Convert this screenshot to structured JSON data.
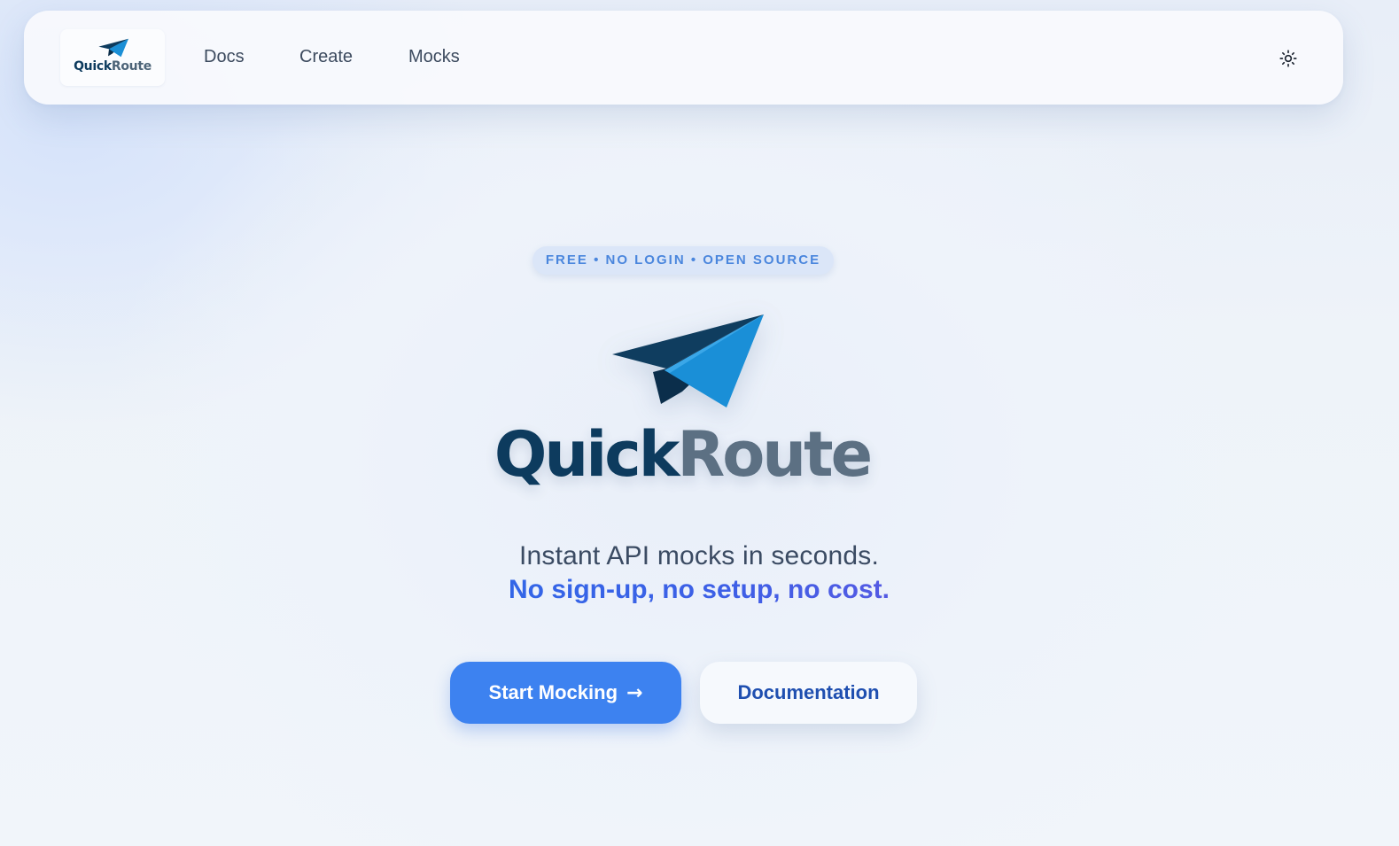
{
  "nav": {
    "logo": {
      "word_part1": "Quick",
      "word_part2": "Route",
      "icon": "paper-plane-icon"
    },
    "links": [
      {
        "label": "Docs"
      },
      {
        "label": "Create"
      },
      {
        "label": "Mocks"
      }
    ],
    "theme_toggle": {
      "icon": "sun-icon"
    }
  },
  "hero": {
    "badge": "FREE • NO LOGIN • OPEN SOURCE",
    "logo": {
      "word_part1": "Quick",
      "word_part2": "Route",
      "icon": "paper-plane-icon"
    },
    "tagline": "Instant API mocks in seconds.",
    "tagline_accent": "No sign-up, no setup, no cost.",
    "primary_button": {
      "label": "Start Mocking",
      "arrow": "→"
    },
    "secondary_button": {
      "label": "Documentation"
    }
  },
  "colors": {
    "brand_dark": "#0d3b5e",
    "brand_gray": "#5c7083",
    "primary": "#3d82f0",
    "accent_text": "#2a6be8",
    "badge_text": "#4a86dd",
    "badge_bg": "#dbe6f8"
  }
}
